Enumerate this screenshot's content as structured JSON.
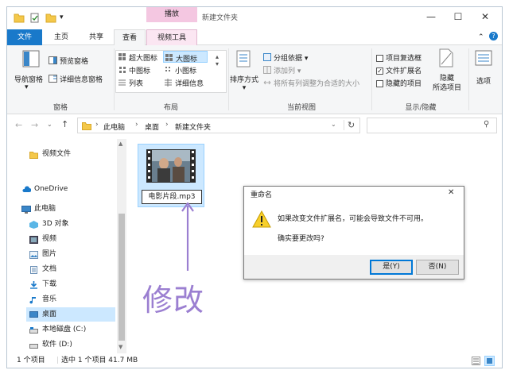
{
  "window": {
    "context_tab": "播放",
    "title": "新建文件夹",
    "min_glyph": "—",
    "max_glyph": "☐",
    "close_glyph": "✕"
  },
  "tabs": {
    "file": "文件",
    "home": "主页",
    "share": "共享",
    "view": "查看",
    "video_tools": "视频工具"
  },
  "ribbon": {
    "panes": {
      "nav_pane": "导航窗格",
      "preview_pane": "预览窗格",
      "details_pane": "详细信息窗格",
      "group": "窗格"
    },
    "layout": {
      "xlarge_icons": "超大图标",
      "large_icons": "大图标",
      "medium_icons": "中图标",
      "small_icons": "小图标",
      "list": "列表",
      "details": "详细信息",
      "group": "布局"
    },
    "current_view": {
      "sort_by": "排序方式",
      "group_by": "分组依据",
      "add_columns": "添加列",
      "size_all_columns": "将所有列调整为合适的大小",
      "group": "当前视图"
    },
    "show_hide": {
      "item_checkboxes": "项目复选框",
      "file_extensions": "文件扩展名",
      "hidden_items": "隐藏的项目",
      "hide_selected": "隐藏",
      "hide_selected_2": "所选项目",
      "options": "选项",
      "group": "显示/隐藏",
      "file_extensions_checked": true
    }
  },
  "address": {
    "crumbs": [
      "此电脑",
      "桌面",
      "新建文件夹"
    ]
  },
  "nav": {
    "items": [
      {
        "label": "视频文件",
        "icon": "folder-icon"
      },
      {
        "label": "OneDrive",
        "icon": "cloud-icon"
      },
      {
        "label": "此电脑",
        "icon": "computer-icon"
      },
      {
        "label": "3D 对象",
        "icon": "cube-icon"
      },
      {
        "label": "视频",
        "icon": "video-icon"
      },
      {
        "label": "图片",
        "icon": "picture-icon"
      },
      {
        "label": "文档",
        "icon": "document-icon"
      },
      {
        "label": "下载",
        "icon": "download-icon"
      },
      {
        "label": "音乐",
        "icon": "music-icon"
      },
      {
        "label": "桌面",
        "icon": "desktop-icon"
      },
      {
        "label": "本地磁盘 (C:)",
        "icon": "drive-icon"
      },
      {
        "label": "软件 (D:)",
        "icon": "drive-icon"
      }
    ]
  },
  "file": {
    "name": "电影片段.mp3"
  },
  "annotation": {
    "text": "修改",
    "color": "#9b7fd1"
  },
  "dialog": {
    "title": "重命名",
    "message": "如果改变文件扩展名，可能会导致文件不可用。",
    "question": "确实要更改吗?",
    "yes": "是(Y)",
    "no": "否(N)"
  },
  "status": {
    "count": "1 个项目",
    "selection": "选中 1 个项目  41.7 MB"
  },
  "colors": {
    "accent": "#1979ca",
    "selection": "#cce8ff",
    "context_tab": "#f4c7e1"
  }
}
